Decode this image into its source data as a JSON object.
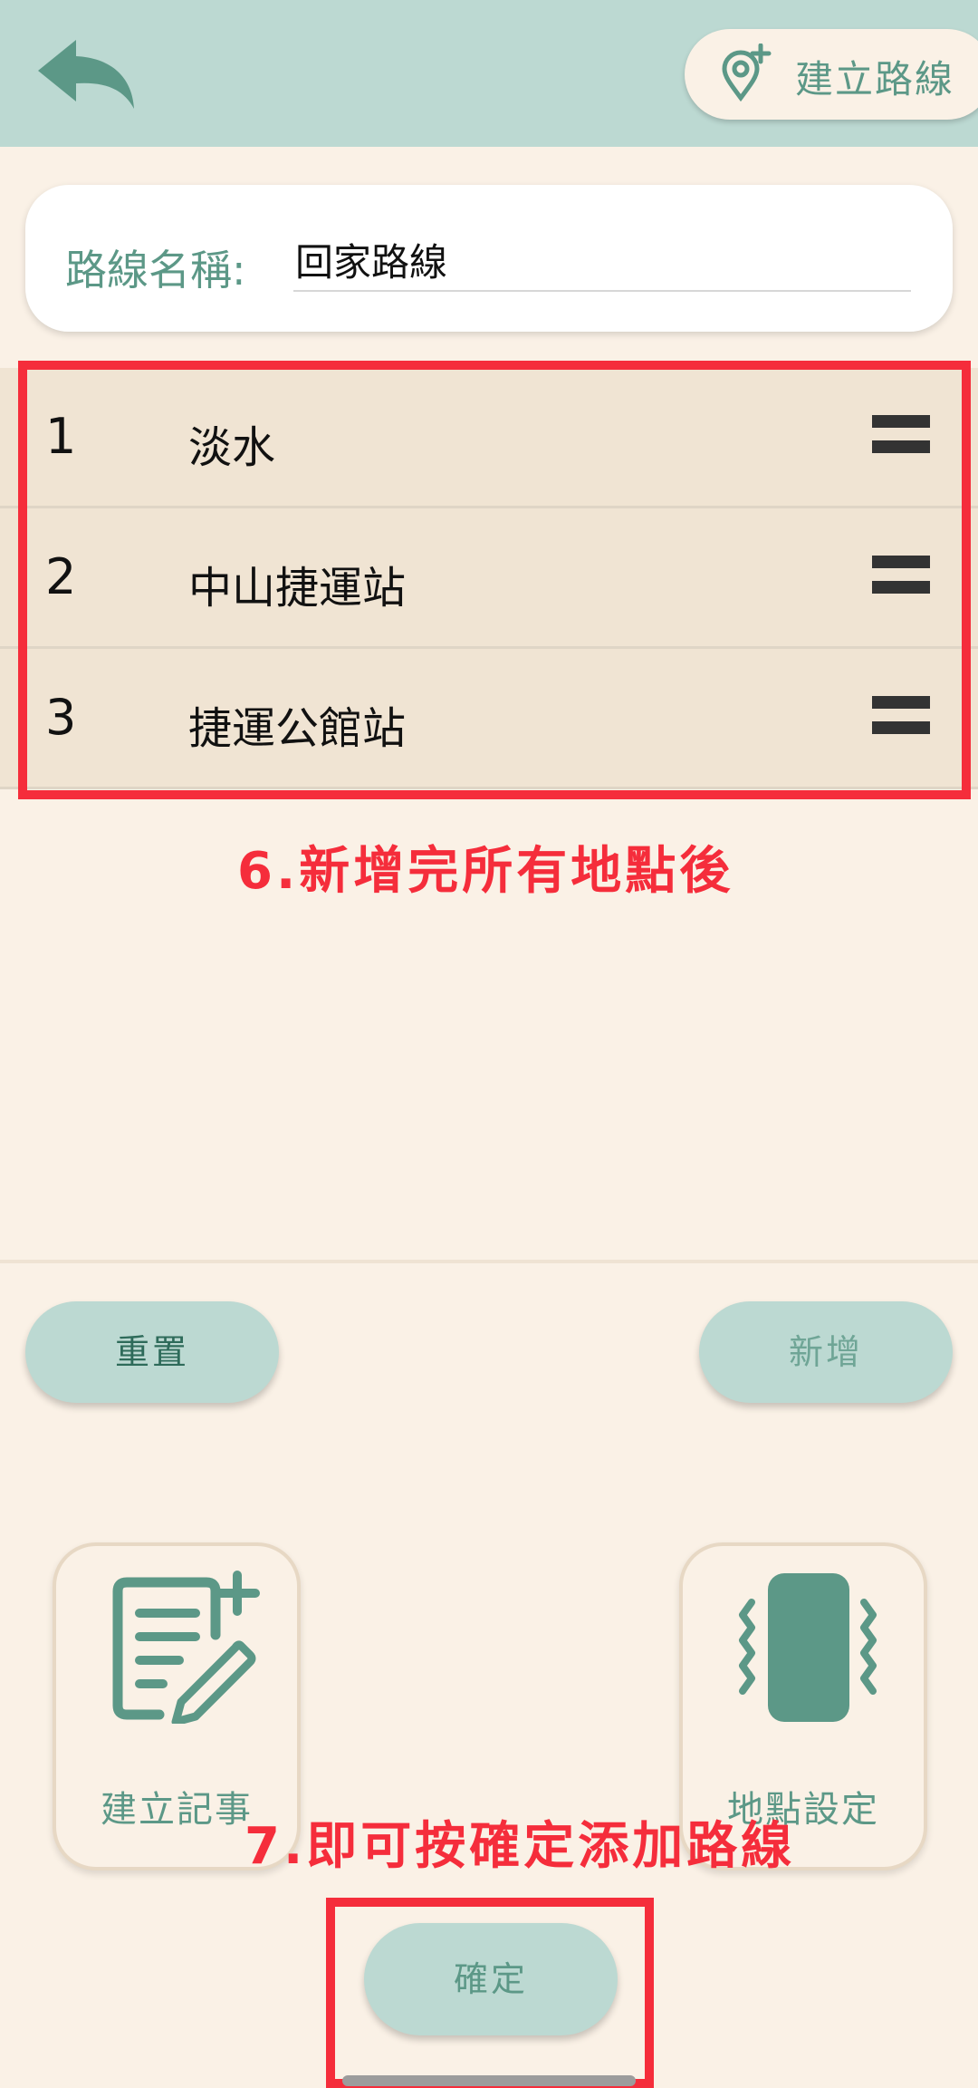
{
  "header": {
    "create_route_label": "建立路線",
    "accent_color": "#5c9887",
    "bar_color": "#bcd9d2"
  },
  "route_name": {
    "label": "路線名稱:",
    "value": "回家路線"
  },
  "stops": [
    {
      "index": "1",
      "name": "淡水"
    },
    {
      "index": "2",
      "name": "中山捷運站"
    },
    {
      "index": "3",
      "name": "捷運公館站"
    }
  ],
  "actions": {
    "reset_label": "重置",
    "add_label": "新增"
  },
  "tiles": {
    "create_note_label": "建立記事",
    "location_settings_label": "地點設定"
  },
  "confirm_label": "確定",
  "annotations": {
    "step6": "6.新增完所有地點後",
    "step7": "7.即可按確定添加路線",
    "color": "#f52d3b"
  }
}
